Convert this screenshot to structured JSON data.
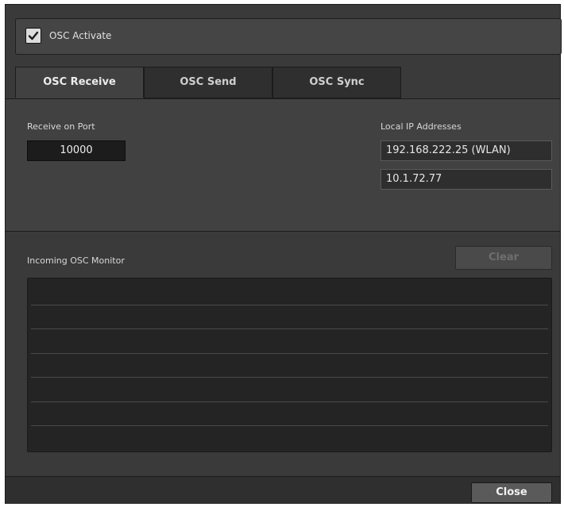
{
  "activate": {
    "label": "OSC Activate",
    "checked": true
  },
  "tabs": [
    {
      "label": "OSC Receive",
      "active": true
    },
    {
      "label": "OSC Send",
      "active": false
    },
    {
      "label": "OSC Sync",
      "active": false
    }
  ],
  "receive": {
    "port_label": "Receive on Port",
    "port_value": "10000",
    "ip_label": "Local IP Addresses",
    "ip_addresses": [
      "192.168.222.25 (WLAN)",
      "10.1.72.77"
    ]
  },
  "monitor": {
    "label": "Incoming OSC Monitor",
    "clear_label": "Clear",
    "clear_enabled": false
  },
  "footer": {
    "close_label": "Close"
  },
  "icons": {
    "checkbox": "checkmark-icon"
  }
}
